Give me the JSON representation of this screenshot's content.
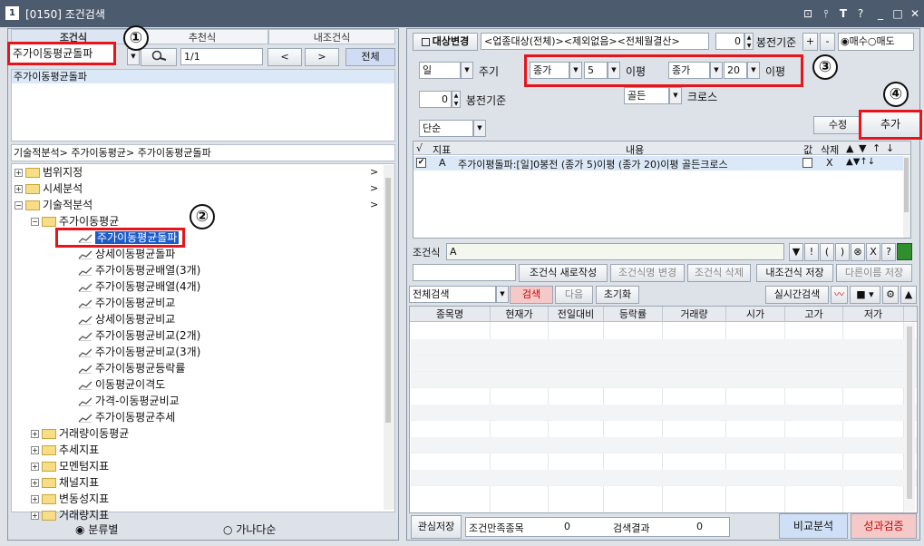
{
  "window": {
    "number": "1",
    "title": "[0150] 조건검색"
  },
  "window_controls": [
    "⊡",
    "📌",
    "T",
    "?",
    "_",
    "□",
    "✕"
  ],
  "left": {
    "tabs": [
      "조건식",
      "추천식",
      "내조건식"
    ],
    "search_value": "주가이동평균돌파",
    "page_indicator": "1/1",
    "prev_label": "<",
    "next_label": ">",
    "all_label": "전체",
    "result_item": "주가이동평균돌파",
    "breadcrumb": "기술적분석> 주가이동평균> 주가이동평균돌파",
    "tree": [
      {
        "label": "범위지정",
        "level": 0,
        "type": "folder",
        "arrow": ">"
      },
      {
        "label": "시세분석",
        "level": 0,
        "type": "folder",
        "arrow": ">"
      },
      {
        "label": "기술적분석",
        "level": 0,
        "type": "folder-open",
        "arrow": ">"
      },
      {
        "label": "주가이동평균",
        "level": 1,
        "type": "folder-open"
      },
      {
        "label": "주가이동평균돌파",
        "level": 2,
        "type": "chart",
        "selected": true
      },
      {
        "label": "상세이동평균돌파",
        "level": 2,
        "type": "chart"
      },
      {
        "label": "주가이동평균배열(3개)",
        "level": 2,
        "type": "chart"
      },
      {
        "label": "주가이동평균배열(4개)",
        "level": 2,
        "type": "chart"
      },
      {
        "label": "주가이동평균비교",
        "level": 2,
        "type": "chart"
      },
      {
        "label": "상세이동평균비교",
        "level": 2,
        "type": "chart"
      },
      {
        "label": "주가이동평균비교(2개)",
        "level": 2,
        "type": "chart"
      },
      {
        "label": "주가이동평균비교(3개)",
        "level": 2,
        "type": "chart"
      },
      {
        "label": "주가이동평균등락률",
        "level": 2,
        "type": "chart"
      },
      {
        "label": "이동평균이격도",
        "level": 2,
        "type": "chart"
      },
      {
        "label": "가격-이동평균비교",
        "level": 2,
        "type": "chart"
      },
      {
        "label": "주가이동평균추세",
        "level": 2,
        "type": "chart"
      },
      {
        "label": "거래량이동평균",
        "level": 1,
        "type": "folder"
      },
      {
        "label": "추세지표",
        "level": 1,
        "type": "folder"
      },
      {
        "label": "모멘텀지표",
        "level": 1,
        "type": "folder"
      },
      {
        "label": "채널지표",
        "level": 1,
        "type": "folder"
      },
      {
        "label": "변동성지표",
        "level": 1,
        "type": "folder"
      },
      {
        "label": "거래량지표",
        "level": 1,
        "type": "folder"
      }
    ],
    "radio_category": "분류별",
    "radio_alpha": "가나다순"
  },
  "right": {
    "target_change_label": "대상변경",
    "target_value": "<업종대상(전체)><제외없음><전체월결산>",
    "bong_value": "0",
    "bong_label": "봉전기준",
    "plus": "+",
    "minus": "-",
    "buy_label": "매수",
    "sell_label": "매도",
    "period_value": "일",
    "period_label": "주기",
    "bong2_value": "0",
    "bong2_label": "봉전기준",
    "simple_value": "단순",
    "param1_value": "종가",
    "param1_n": "5",
    "param1_unit": "이평",
    "param2_value": "종가",
    "param2_n": "20",
    "param2_unit": "이평",
    "cross_value": "골든",
    "cross_label": "크로스",
    "edit_label": "수정",
    "add_label": "추가",
    "cond_headers": [
      "√",
      "지표",
      "내용",
      "값",
      "삭제",
      "▲",
      "▼",
      "↑",
      "↓"
    ],
    "cond_row": {
      "checked": true,
      "index": "A",
      "content": "주가이평돌파:[일]0봉전 (종가 5)이평 (종가 20)이평 골든크로스",
      "del": "X"
    },
    "expr_label": "조건식",
    "expr_value": "A",
    "expr_btns": [
      "▼",
      "!",
      "(",
      ")",
      "⊗",
      "X",
      "?"
    ],
    "new_label": "조건식 새로작성",
    "rename_label": "조건식명 변경",
    "delete_label": "조건식 삭제",
    "save_label": "내조건식 저장",
    "saveas_label": "다른이름 저장",
    "search_scope": "전체검색",
    "search_label": "검색",
    "next_label": "다음",
    "reset_label": "초기화",
    "realtime_label": "실시간검색",
    "grid_headers": [
      "종목명",
      "현재가",
      "전일대비",
      "등락률",
      "거래량",
      "시가",
      "고가",
      "저가"
    ],
    "watch_save_label": "관심저장",
    "matched_label": "조건만족종목",
    "matched_value": "0",
    "result_label": "검색결과",
    "result_value": "0",
    "compare_label": "비교분석",
    "perf_label": "성과검증"
  },
  "callouts": [
    "①",
    "②",
    "③",
    "④"
  ],
  "colors": {
    "highlight_red": "#e8141c",
    "selection_blue": "#1c5cc8",
    "title_bar": "#4d5b6e",
    "perf_button": "#f6c9c9",
    "compare_button": "#cfe0f6"
  }
}
